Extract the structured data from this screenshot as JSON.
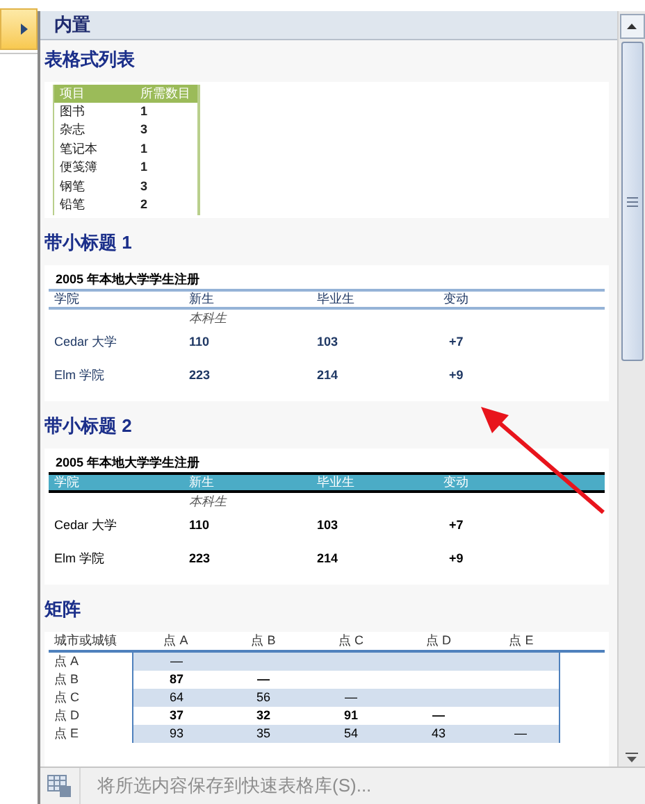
{
  "header": "内置",
  "sections": [
    {
      "kind": "list",
      "title": "表格式列表",
      "columns": [
        "项目",
        "所需数目"
      ],
      "rows": [
        [
          "图书",
          "1"
        ],
        [
          "杂志",
          "3"
        ],
        [
          "笔记本",
          "1"
        ],
        [
          "便笺簿",
          "1"
        ],
        [
          "钢笔",
          "3"
        ],
        [
          "铅笔",
          "2"
        ]
      ]
    },
    {
      "kind": "subheading_line",
      "title": "带小标题 1",
      "caption": "2005  年本地大学学生注册",
      "columns": [
        "学院",
        "新生",
        "毕业生",
        "变动"
      ],
      "subheader": "本科生",
      "rows": [
        [
          "Cedar  大学",
          "110",
          "103",
          "+7"
        ],
        [
          "Elm  学院",
          "223",
          "214",
          "+9"
        ]
      ]
    },
    {
      "kind": "subheading_banner",
      "title": "带小标题 2",
      "caption": "2005  年本地大学学生注册",
      "columns": [
        "学院",
        "新生",
        "毕业生",
        "变动"
      ],
      "subheader": "本科生",
      "rows": [
        [
          "Cedar  大学",
          "110",
          "103",
          "+7"
        ],
        [
          "Elm  学院",
          "223",
          "214",
          "+9"
        ]
      ]
    },
    {
      "kind": "matrix",
      "title": "矩阵",
      "columns": [
        "城市或城镇",
        "点  A",
        "点  B",
        "点  C",
        "点  D",
        "点  E"
      ],
      "rows": [
        {
          "shaded": true,
          "cells": [
            "点  A",
            "—",
            "",
            "",
            "",
            ""
          ]
        },
        {
          "shaded": false,
          "cells": [
            "点  B",
            "87",
            "—",
            "",
            "",
            ""
          ]
        },
        {
          "shaded": true,
          "cells": [
            "点  C",
            "64",
            "56",
            "—",
            "",
            ""
          ]
        },
        {
          "shaded": false,
          "cells": [
            "点  D",
            "37",
            "32",
            "91",
            "—",
            ""
          ]
        },
        {
          "shaded": true,
          "cells": [
            "点  E",
            "93",
            "35",
            "54",
            "43",
            "—"
          ]
        }
      ]
    }
  ],
  "footer": {
    "label": "将所选内容保存到快速表格库(S)...",
    "disabled": true
  }
}
